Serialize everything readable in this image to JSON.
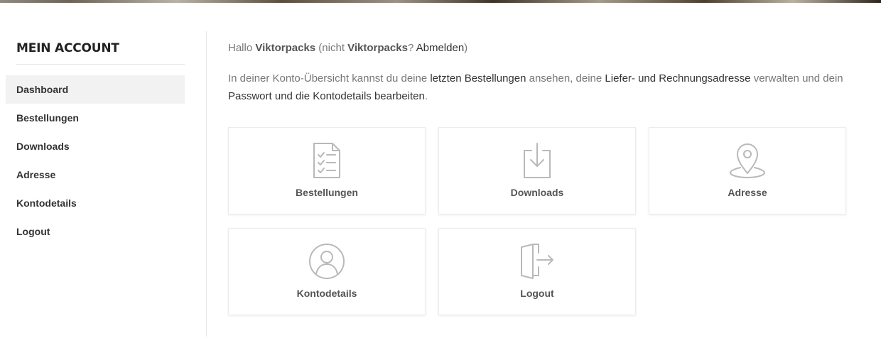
{
  "sidebar": {
    "title": "MEIN ACCOUNT",
    "items": [
      {
        "label": "Dashboard",
        "active": true
      },
      {
        "label": "Bestellungen"
      },
      {
        "label": "Downloads"
      },
      {
        "label": "Adresse"
      },
      {
        "label": "Kontodetails"
      },
      {
        "label": "Logout"
      }
    ]
  },
  "greeting": {
    "hello": "Hallo ",
    "username": "Viktorpacks",
    "not_prefix": " (nicht ",
    "not_user": "Viktorpacks",
    "question": "? ",
    "logout_link": "Abmelden",
    "close": ")"
  },
  "intro": {
    "t1": "In deiner Konto-Übersicht kannst du deine ",
    "l1": "letzten Bestellungen",
    "t2": " ansehen, deine ",
    "l2": "Liefer- und Rechnungsadresse",
    "t3": " verwalten und dein ",
    "l3": "Passwort und die Kontodetails bearbeiten",
    "t4": "."
  },
  "cards": [
    {
      "label": "Bestellungen",
      "icon": "orders-list-icon"
    },
    {
      "label": "Downloads",
      "icon": "download-icon"
    },
    {
      "label": "Adresse",
      "icon": "map-pin-icon"
    },
    {
      "label": "Kontodetails",
      "icon": "user-icon"
    },
    {
      "label": "Logout",
      "icon": "logout-door-icon"
    }
  ],
  "colors": {
    "icon_stroke": "#b9b9b9",
    "active_bg": "#f2f2f2",
    "text_dark": "#333333",
    "text_muted": "#777777"
  }
}
